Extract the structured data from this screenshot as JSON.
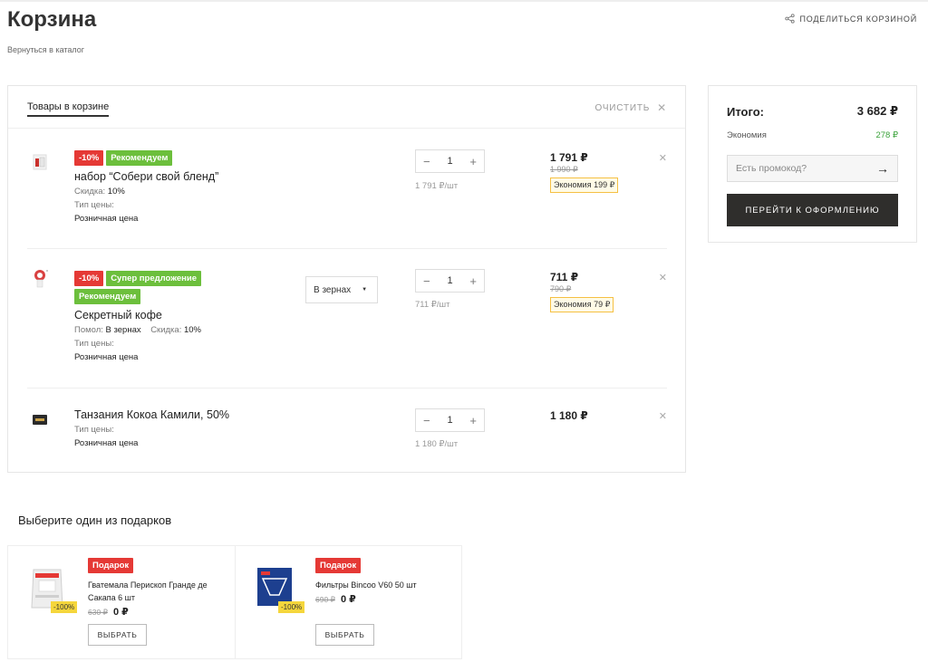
{
  "header": {
    "title": "Корзина",
    "back": "Вернуться в каталог",
    "share": "ПОДЕЛИТЬСЯ КОРЗИНОЙ"
  },
  "cart": {
    "tab": "Товары в корзине",
    "clear": "ОЧИСТИТЬ",
    "items": [
      {
        "badges": [
          "-10%",
          "Рекомендуем"
        ],
        "name": "набор “Собери свой бленд”",
        "discount_label": "Скидка:",
        "discount_value": "10%",
        "price_type_label": "Тип цены:",
        "price_type_value": "Розничная цена",
        "qty": "1",
        "unit_price": "1 791 ₽/шт",
        "price": "1 791 ₽",
        "old_price": "1 990 ₽",
        "saving": "Экономия 199 ₽"
      },
      {
        "badges": [
          "-10%",
          "Супер предложение",
          "Рекомендуем"
        ],
        "name": "Секретный кофе",
        "grind_label": "Помол:",
        "grind_value": "В зернах",
        "discount_label": "Скидка:",
        "discount_value": "10%",
        "price_type_label": "Тип цены:",
        "price_type_value": "Розничная цена",
        "grind_select": "В зернах",
        "qty": "1",
        "unit_price": "711 ₽/шт",
        "price": "711 ₽",
        "old_price": "790 ₽",
        "saving": "Экономия 79 ₽"
      },
      {
        "name": "Танзания Кокоа Камили, 50%",
        "price_type_label": "Тип цены:",
        "price_type_value": "Розничная цена",
        "qty": "1",
        "unit_price": "1 180 ₽/шт",
        "price": "1 180 ₽"
      }
    ]
  },
  "summary": {
    "total_label": "Итого:",
    "total_value": "3 682 ₽",
    "economy_label": "Экономия",
    "economy_value": "278 ₽",
    "promo_placeholder": "Есть промокод?",
    "checkout": "ПЕРЕЙТИ К ОФОРМЛЕНИЮ"
  },
  "gifts": {
    "title": "Выберите один из подарков",
    "items": [
      {
        "badge": "Подарок",
        "name": "Гватемала Перископ Гранде де Сакапа 6 шт",
        "discount": "-100%",
        "old_price": "630 ₽",
        "price": "0 ₽",
        "button": "ВЫБРАТЬ"
      },
      {
        "badge": "Подарок",
        "name": "Фильтры Bincoo V60 50 шт",
        "discount": "-100%",
        "old_price": "690 ₽",
        "price": "0 ₽",
        "button": "ВЫБРАТЬ"
      }
    ]
  },
  "colors": {
    "accent_dark": "#2f2e2c",
    "badge_red": "#e53935",
    "badge_green": "#6cbf3c",
    "economy_green": "#3aa23a",
    "saving_border": "#f5c043"
  }
}
